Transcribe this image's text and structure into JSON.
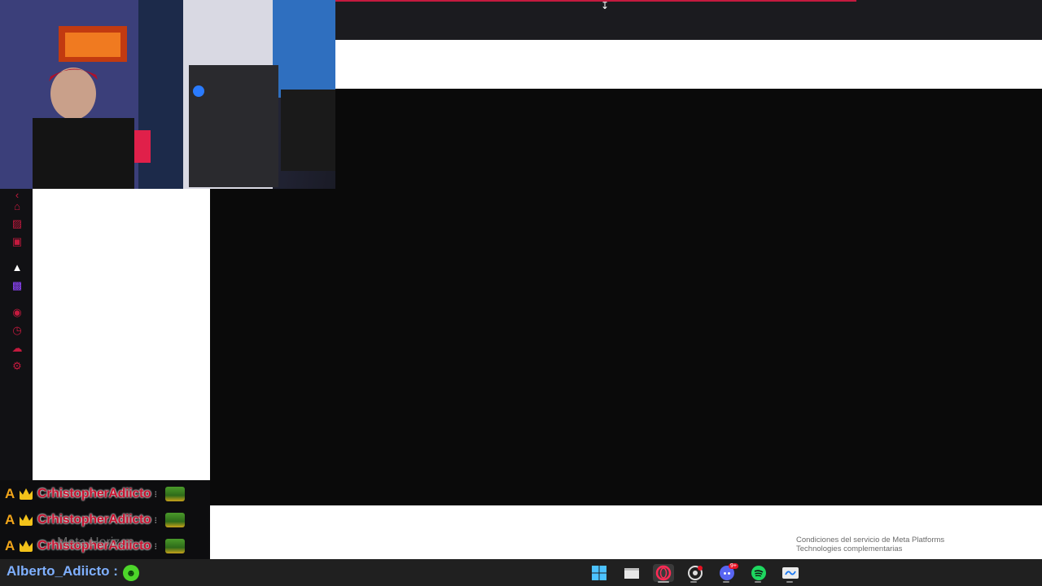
{
  "footer": {
    "line1": "Condiciones del servicio de Meta Platforms",
    "line2": "Technologies complementarias"
  },
  "overlay_text": "Meta Horizon",
  "sidebar": {
    "icons": [
      "back-icon",
      "bag-icon",
      "stripes-icon",
      "m-icon",
      "brand-icon",
      "twitch-icon",
      "play-icon",
      "clock-icon",
      "cloud-icon",
      "settings-icon"
    ]
  },
  "chat": {
    "rows": [
      {
        "badge": "A",
        "name": "CrhistopherAdiicto",
        "sep": "⁝"
      },
      {
        "badge": "A",
        "name": "CrhistopherAdiicto",
        "sep": "⁝"
      },
      {
        "badge": "A",
        "name": "CrhistopherAdiicto",
        "sep": "⁝"
      }
    ]
  },
  "user": {
    "label": "Alberto_Adiicto :",
    "emote": "☻"
  },
  "taskbar": {
    "icons": [
      "windows-icon",
      "file-explorer-icon",
      "opera-gx-icon",
      "chrome-icon",
      "discord-icon",
      "spotify-icon",
      "meta-icon"
    ],
    "discord_badge": "9+"
  },
  "colors": {
    "accent": "#c41a3e",
    "taskbar": "#202020",
    "user_name": "#7fb0ff"
  }
}
